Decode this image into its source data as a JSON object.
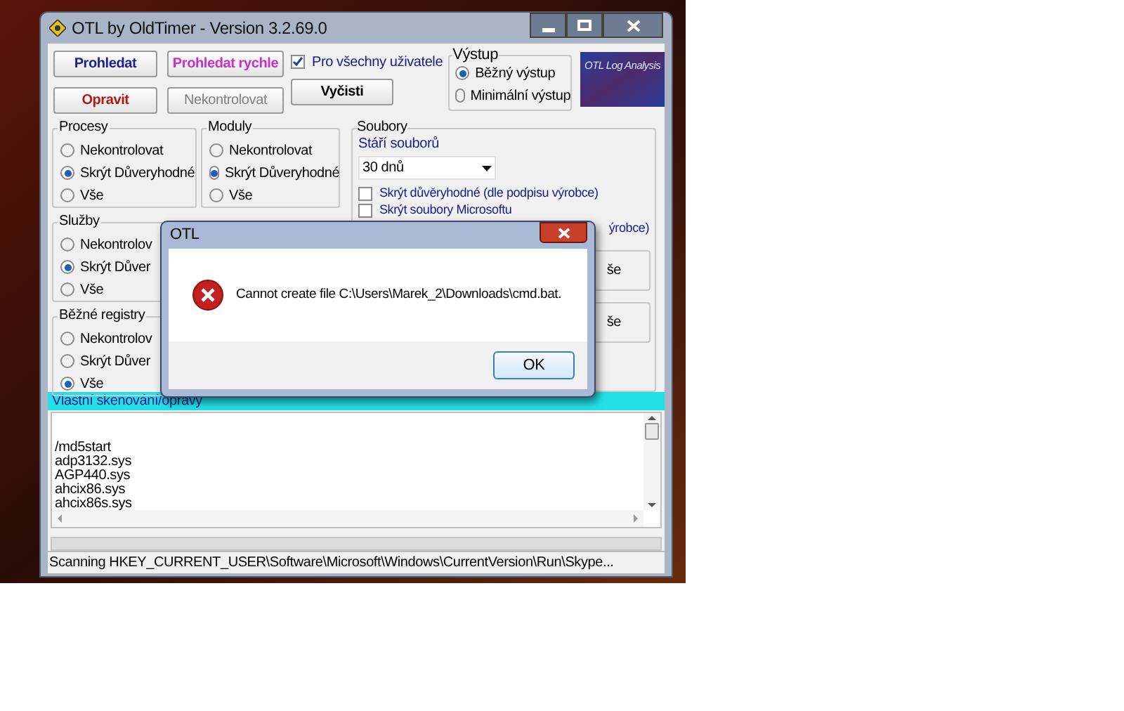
{
  "window": {
    "title": "OTL by OldTimer - Version 3.2.69.0"
  },
  "buttons": [
    {
      "label": "Prohledat",
      "color": "#1f1f8f",
      "disabled": false
    },
    {
      "label": "Prohledat rychle",
      "color": "#c830c8",
      "disabled": false
    },
    {
      "label": "Opravit",
      "color": "#b01818",
      "disabled": false
    },
    {
      "label": "Nekontrolovat",
      "color": "#808080",
      "disabled": true
    }
  ],
  "clear_button": {
    "label": "Vyčisti"
  },
  "all_users": {
    "label": "Pro všechny uživatele",
    "checked": true
  },
  "output": {
    "title": "Výstup",
    "options": [
      {
        "label": "Běžný výstup",
        "selected": true
      },
      {
        "label": "Minimální výstup",
        "selected": false
      }
    ]
  },
  "logo": {
    "title": "OTL Log Analysis"
  },
  "groups": [
    {
      "title": "Procesy",
      "options": [
        {
          "label": "Nekontrolovat",
          "selected": false
        },
        {
          "label": "Skrýt Důveryhodné",
          "selected": true
        },
        {
          "label": "Vše",
          "selected": false
        }
      ]
    },
    {
      "title": "Moduly",
      "options": [
        {
          "label": "Nekontrolovat",
          "selected": false
        },
        {
          "label": "Skrýt Důveryhodné",
          "selected": true
        },
        {
          "label": "Vše",
          "selected": false
        }
      ]
    },
    {
      "title": "Služby",
      "options": [
        {
          "label": "Nekontrolov",
          "selected": false
        },
        {
          "label": "Skrýt Důver",
          "selected": true
        },
        {
          "label": "Vše",
          "selected": false
        }
      ]
    },
    {
      "title": "Běžné registry",
      "options": [
        {
          "label": "Nekontrolov",
          "selected": false
        },
        {
          "label": "Skrýt Důver",
          "selected": false
        },
        {
          "label": "Vše",
          "selected": true
        }
      ]
    }
  ],
  "files": {
    "title": "Soubory",
    "age_label": "Stáří souborů",
    "age_value": "30 dnů",
    "checkboxes": [
      {
        "label": "Skrýt důvěryhodné (dle podpisu výrobce)",
        "checked": false
      },
      {
        "label": "Skrýt soubory Microsoftu",
        "checked": false
      }
    ],
    "cut_label": "ýrobce)",
    "cut_options": [
      "še",
      "še"
    ]
  },
  "custom_scan": {
    "title": "Vlastní skenování/opravy",
    "lines": [
      "/md5start",
      "adp3132.sys",
      "AGP440.sys",
      "ahcix86.sys",
      "ahcix86s.sys"
    ]
  },
  "progress": {
    "level": 0
  },
  "status_bar": "Scanning HKEY_CURRENT_USER\\Software\\Microsoft\\Windows\\CurrentVersion\\Run\\Skype...",
  "dialog": {
    "title": "OTL",
    "message": "Cannot create file C:\\Users\\Marek_2\\Downloads\\cmd.bat.",
    "buttons": [
      "OK"
    ]
  }
}
